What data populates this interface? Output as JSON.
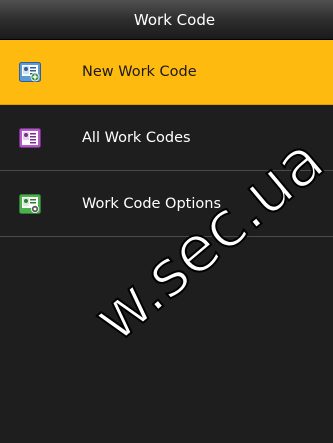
{
  "header": {
    "title": "Work Code"
  },
  "menu": {
    "items": [
      {
        "label": "New Work Code",
        "icon": "new-work-code-icon",
        "selected": true
      },
      {
        "label": "All Work Codes",
        "icon": "all-work-codes-icon",
        "selected": false
      },
      {
        "label": "Work Code Options",
        "icon": "work-code-options-icon",
        "selected": false
      }
    ]
  },
  "watermark": {
    "text": "w.sec.ua"
  },
  "colors": {
    "highlight": "#ffba10",
    "background": "#1e1e1e",
    "divider": "#4a4a4a",
    "icon_blue": "#5b9ad6",
    "icon_purple": "#b25ac6",
    "icon_green": "#4caf50"
  }
}
